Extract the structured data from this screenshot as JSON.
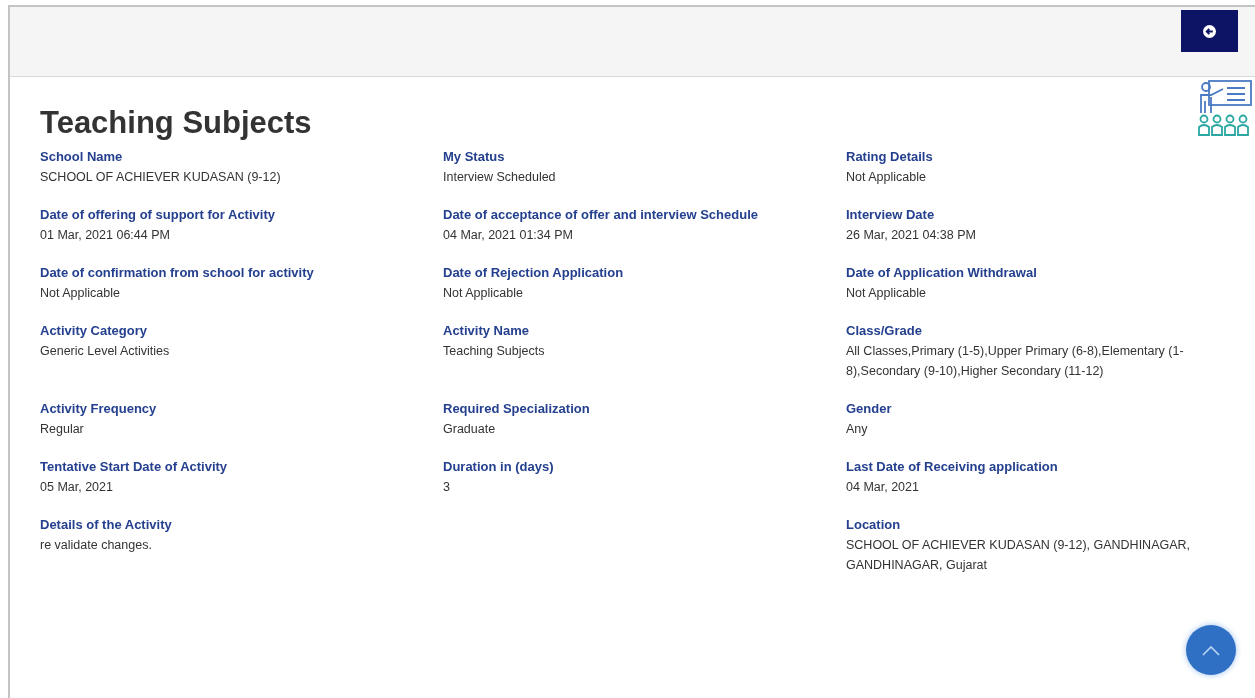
{
  "title": "Teaching Subjects",
  "rows": [
    [
      {
        "label": "School Name",
        "value": "SCHOOL OF ACHIEVER KUDASAN (9-12)"
      },
      {
        "label": "My Status",
        "value": "Interview Scheduled"
      },
      {
        "label": "Rating Details",
        "value": "Not Applicable"
      }
    ],
    [
      {
        "label": "Date of offering of support for Activity",
        "value": "01 Mar, 2021 06:44 PM"
      },
      {
        "label": "Date of acceptance of offer and interview Schedule",
        "value": "04 Mar, 2021 01:34 PM"
      },
      {
        "label": "Interview Date",
        "value": "26 Mar, 2021 04:38 PM"
      }
    ],
    [
      {
        "label": "Date of confirmation from school for activity",
        "value": "Not Applicable"
      },
      {
        "label": "Date of Rejection Application",
        "value": "Not Applicable"
      },
      {
        "label": "Date of Application Withdrawal",
        "value": "Not Applicable"
      }
    ],
    [
      {
        "label": "Activity Category",
        "value": "Generic Level Activities"
      },
      {
        "label": "Activity Name",
        "value": "Teaching Subjects"
      },
      {
        "label": "Class/Grade",
        "value": "All Classes,Primary (1-5),Upper Primary (6-8),Elementary (1-8),Secondary (9-10),Higher Secondary (11-12)"
      }
    ],
    [
      {
        "label": "Activity Frequency",
        "value": "Regular"
      },
      {
        "label": "Required Specialization",
        "value": "Graduate"
      },
      {
        "label": "Gender",
        "value": "Any"
      }
    ],
    [
      {
        "label": "Tentative Start Date of Activity",
        "value": "05 Mar, 2021"
      },
      {
        "label": "Duration in (days)",
        "value": "3"
      },
      {
        "label": "Last Date of Receiving application",
        "value": "04 Mar, 2021"
      }
    ],
    [
      {
        "label": "Details of the Activity",
        "value": "re validate changes."
      },
      {
        "label": "Location",
        "value": "SCHOOL OF ACHIEVER KUDASAN (9-12), GANDHINAGAR, GANDHINAGAR, Gujarat"
      }
    ]
  ]
}
